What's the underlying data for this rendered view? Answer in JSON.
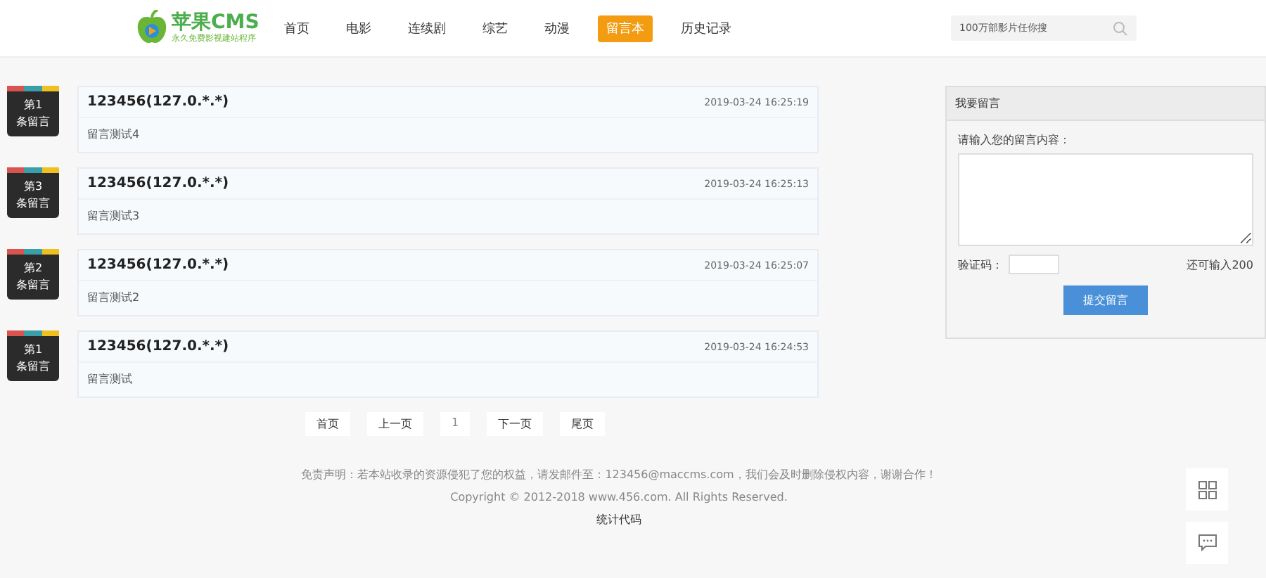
{
  "header": {
    "logo": {
      "title": "苹果CMS",
      "subtitle": "永久免费影视建站程序"
    },
    "nav": [
      {
        "label": "首页",
        "selected": false
      },
      {
        "label": "电影",
        "selected": false
      },
      {
        "label": "连续剧",
        "selected": false
      },
      {
        "label": "综艺",
        "selected": false
      },
      {
        "label": "动漫",
        "selected": false
      },
      {
        "label": "留言本",
        "selected": true
      },
      {
        "label": "历史记录",
        "selected": false
      }
    ],
    "search": {
      "placeholder": "100万部影片任你搜"
    }
  },
  "messages": [
    {
      "badge_top": "第1",
      "badge_bottom": "条留言",
      "author": "123456(127.0.*.*)",
      "time": "2019-03-24 16:25:19",
      "content": "留言测试4"
    },
    {
      "badge_top": "第3",
      "badge_bottom": "条留言",
      "author": "123456(127.0.*.*)",
      "time": "2019-03-24 16:25:13",
      "content": "留言测试3"
    },
    {
      "badge_top": "第2",
      "badge_bottom": "条留言",
      "author": "123456(127.0.*.*)",
      "time": "2019-03-24 16:25:07",
      "content": "留言测试2"
    },
    {
      "badge_top": "第1",
      "badge_bottom": "条留言",
      "author": "123456(127.0.*.*)",
      "time": "2019-03-24 16:24:53",
      "content": "留言测试"
    }
  ],
  "pagination": [
    {
      "label": "首页",
      "selected": false
    },
    {
      "label": "上一页",
      "selected": false
    },
    {
      "label": "1",
      "selected": true
    },
    {
      "label": "下一页",
      "selected": false
    },
    {
      "label": "尾页",
      "selected": false
    }
  ],
  "form": {
    "title": "我要留言",
    "prompt": "请输入您的留言内容：",
    "captcha_label": "验证码：",
    "remaining": "还可输入200",
    "submit": "提交留言"
  },
  "footer": {
    "disclaimer": "免责声明：若本站收录的资源侵犯了您的权益，请发邮件至：123456@maccms.com，我们会及时删除侵权内容，谢谢合作！",
    "copyright": "Copyright © 2012-2018 www.456.com. All Rights Reserved.",
    "stats": "统计代码"
  }
}
